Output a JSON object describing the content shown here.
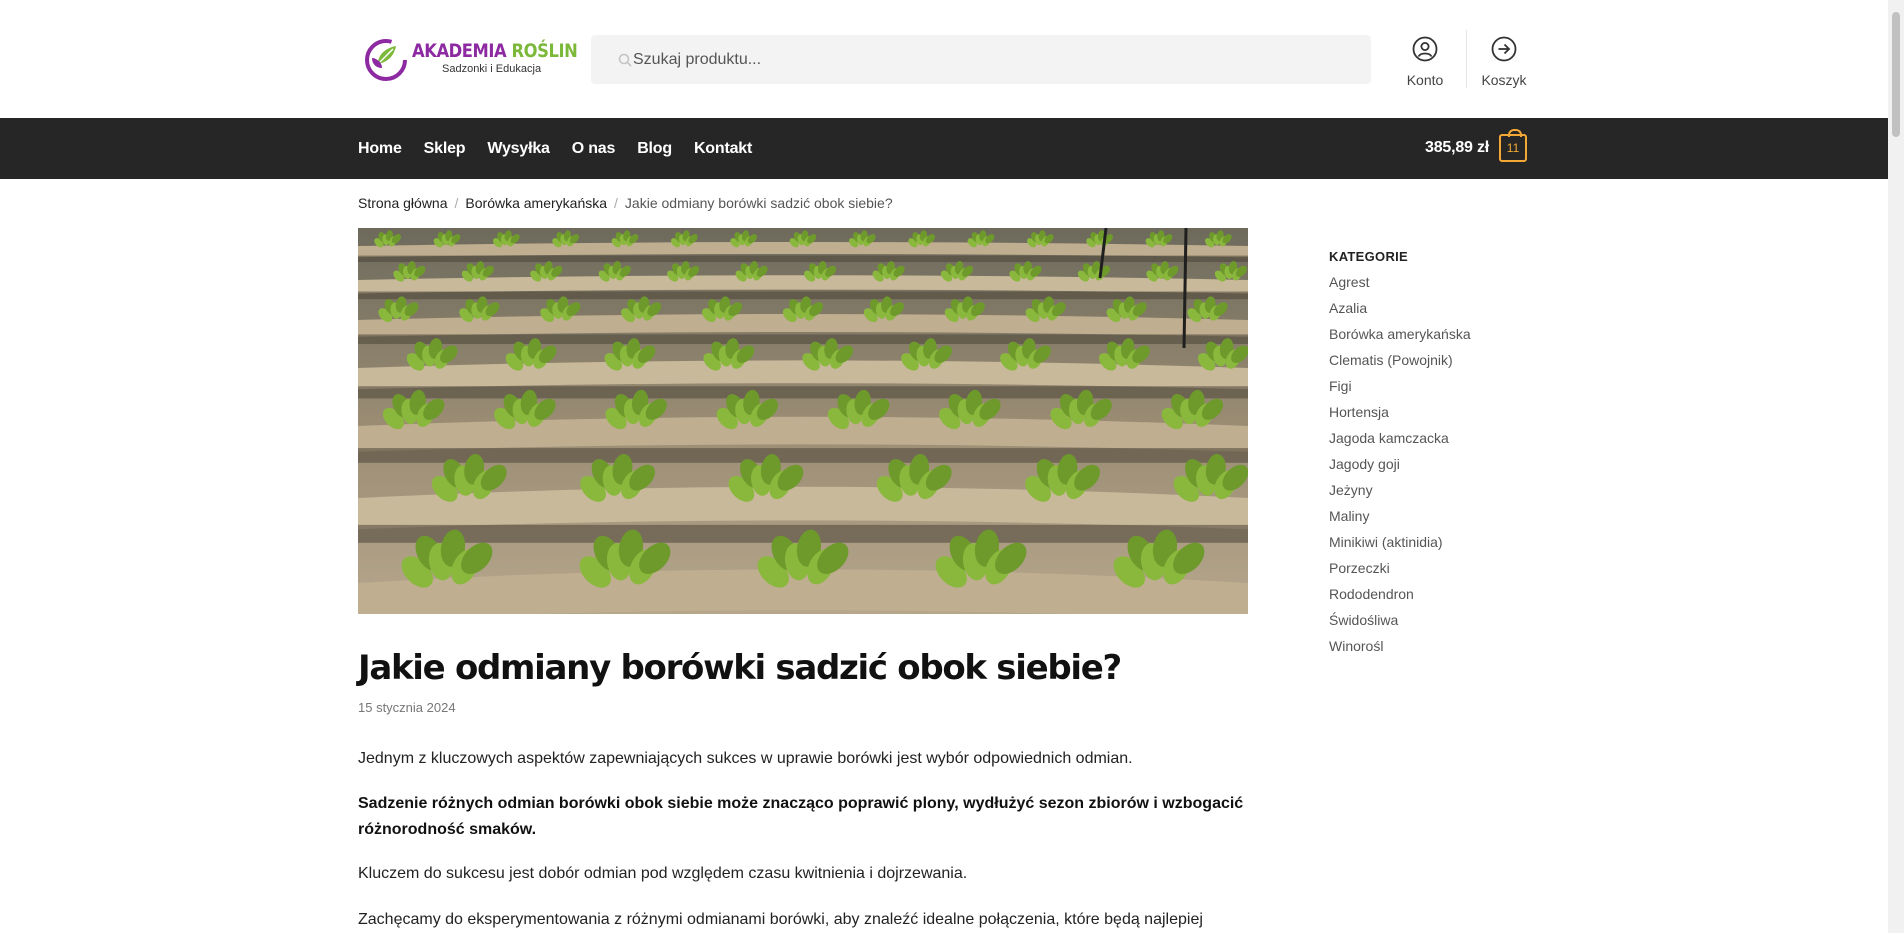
{
  "logo": {
    "title_part1": "AKADEMIA",
    "title_part2": "ROŚLIN",
    "subtitle": "Sadzonki i Edukacja"
  },
  "search": {
    "placeholder": "Szukaj produktu..."
  },
  "header_links": {
    "account": "Konto",
    "cart": "Koszyk"
  },
  "nav": {
    "items": [
      "Home",
      "Sklep",
      "Wysyłka",
      "O nas",
      "Blog",
      "Kontakt"
    ],
    "cart_total": "385,89 zł",
    "cart_count": "11"
  },
  "breadcrumb": {
    "items": [
      "Strona główna",
      "Borówka amerykańska"
    ],
    "current": "Jakie odmiany borówki sadzić obok siebie?"
  },
  "article": {
    "title": "Jakie odmiany borówki sadzić obok siebie?",
    "date": "15 stycznia 2024",
    "paragraphs": [
      "Jednym z kluczowych aspektów zapewniających sukces w uprawie borówki jest wybór odpowiednich odmian.",
      "Sadzenie różnych odmian borówki obok siebie może znacząco poprawić plony, wydłużyć sezon zbiorów i wzbogacić różnorodność smaków.",
      "Kluczem do sukcesu jest dobór odmian pod względem czasu kwitnienia i dojrzewania.",
      "Zachęcamy do eksperymentowania z różnymi odmianami borówki, aby znaleźć idealne połączenia, które będą najlepiej"
    ]
  },
  "sidebar": {
    "heading": "KATEGORIE",
    "categories": [
      "Agrest",
      "Azalia",
      "Borówka amerykańska",
      "Clematis (Powojnik)",
      "Figi",
      "Hortensja",
      "Jagoda kamczacka",
      "Jagody goji",
      "Jeżyny",
      "Maliny",
      "Minikiwi (aktinidia)",
      "Porzeczki",
      "Rododendron",
      "Świdośliwa",
      "Winorośl"
    ]
  },
  "colors": {
    "brand_purple": "#8d2aa2",
    "brand_green": "#7cb83a",
    "nav_bg": "#262626",
    "cart_accent": "#f3a836"
  },
  "icons": {
    "search": "search-icon",
    "account": "user-circle-icon",
    "cart": "arrow-circle-right-icon",
    "bag": "shopping-bag-icon"
  }
}
